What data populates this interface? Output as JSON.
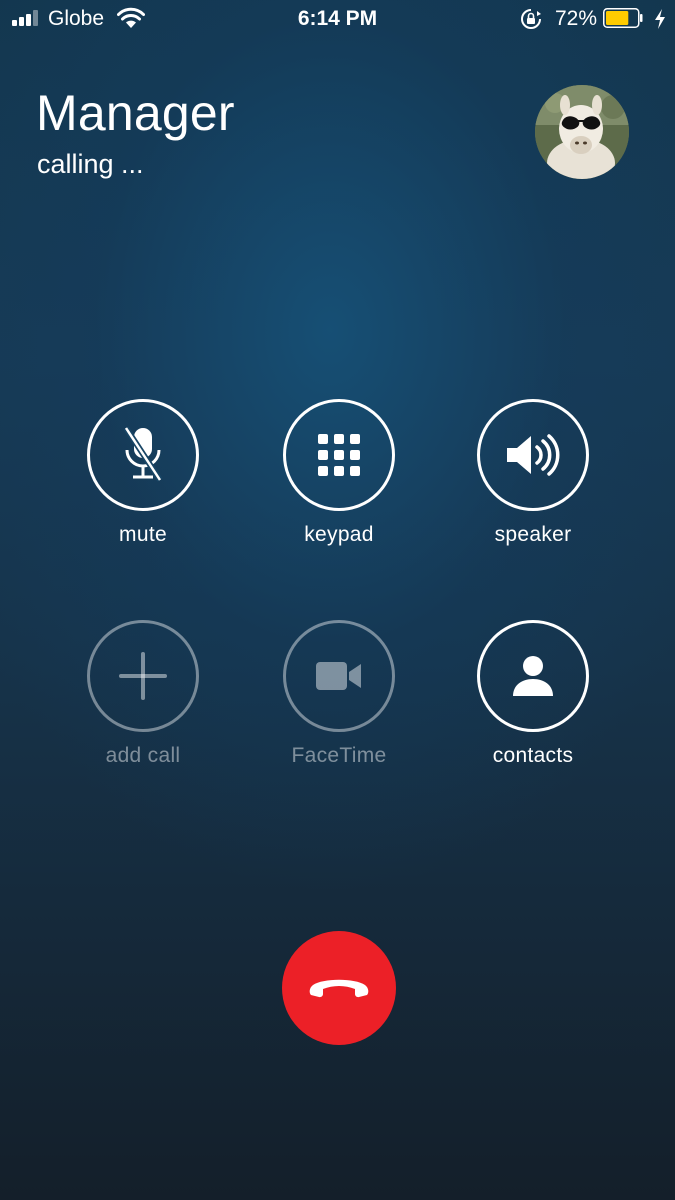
{
  "status_bar": {
    "carrier": "Globe",
    "time": "6:14 PM",
    "battery_percent": "72%",
    "battery_level": 0.72,
    "battery_color": "#ffcc00"
  },
  "caller": {
    "name": "Manager",
    "status": "calling ..."
  },
  "controls": {
    "mute": "mute",
    "keypad": "keypad",
    "speaker": "speaker",
    "add_call": "add call",
    "facetime": "FaceTime",
    "contacts": "contacts"
  },
  "end_call_color": "#ec2027",
  "icons": [
    "signal-icon",
    "wifi-icon",
    "rotation-lock-icon",
    "battery-icon",
    "charging-icon",
    "mic-off-icon",
    "keypad-grid-icon",
    "speaker-icon",
    "plus-icon",
    "video-camera-icon",
    "person-icon",
    "phone-hangup-icon"
  ]
}
